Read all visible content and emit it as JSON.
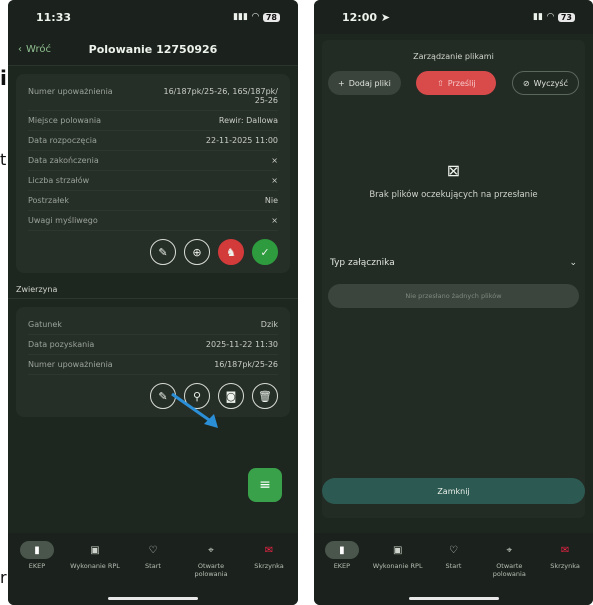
{
  "edge": {
    "bold_letter": "i",
    "t_letter": "t",
    "r_letter": "r"
  },
  "phone1": {
    "time": "11:33",
    "battery": "78",
    "back_label": "Wróć",
    "title": "Polowanie 12750926",
    "details": [
      {
        "label": "Numer upoważnienia",
        "value": "16/187pk/25-26, 16S/187pk/ 25-26"
      },
      {
        "label": "Miejsce polowania",
        "value": "Rewir: Dallowa"
      },
      {
        "label": "Data rozpoczęcia",
        "value": "22-11-2025 11:00"
      },
      {
        "label": "Data zakończenia",
        "value": "×"
      },
      {
        "label": "Liczba strzałów",
        "value": "×"
      },
      {
        "label": "Postrzałek",
        "value": "Nie"
      },
      {
        "label": "Uwagi myśliwego",
        "value": "×"
      }
    ],
    "section_title": "Zwierzyna",
    "game": [
      {
        "label": "Gatunek",
        "value": "Dzik"
      },
      {
        "label": "Data pozyskania",
        "value": "2025-11-22 11:30"
      },
      {
        "label": "Numer upoważnienia",
        "value": "16/187pk/25-26"
      }
    ],
    "tabs": [
      {
        "label": "EKEP",
        "icon": "document-icon"
      },
      {
        "label": "Wykonanie RPL",
        "icon": "calendar-icon"
      },
      {
        "label": "Start",
        "icon": "heart-icon"
      },
      {
        "label": "Otwarte polowania",
        "icon": "target-icon"
      },
      {
        "label": "Skrzynka",
        "icon": "mailbox-icon"
      }
    ],
    "accent": "#3aa14b",
    "danger": "#d33a3a"
  },
  "phone2": {
    "time": "12:00",
    "battery": "73",
    "modal_title": "Zarządzanie plikami",
    "add_label": "Dodaj pliki",
    "send_label": "Prześlij",
    "clear_label": "Wyczyść",
    "empty_text": "Brak plików oczekujących na przesłanie",
    "attachment_label": "Typ załącznika",
    "disabled_label": "Nie przesłano żadnych plików",
    "close_label": "Zamknij",
    "tabs": [
      {
        "label": "EKEP",
        "icon": "document-icon"
      },
      {
        "label": "Wykonanie RPL",
        "icon": "calendar-icon"
      },
      {
        "label": "Start",
        "icon": "heart-icon"
      },
      {
        "label": "Otwarte polowania",
        "icon": "target-icon"
      },
      {
        "label": "Skrzynka",
        "icon": "mailbox-icon"
      }
    ]
  }
}
